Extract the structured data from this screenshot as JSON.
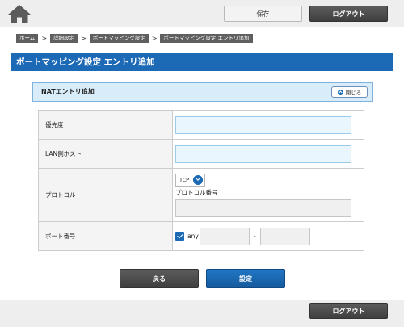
{
  "header": {
    "save_label": "保存",
    "logout_label": "ログアウト"
  },
  "breadcrumb": [
    "ホーム",
    "詳細設定",
    "ポートマッピング設定",
    "ポートマッピング設定 エントリ追加"
  ],
  "page_title": "ポートマッピング設定 エントリ追加",
  "section": {
    "title": "NATエントリ追加",
    "close_label": "閉じる"
  },
  "form": {
    "priority_label": "優先度",
    "priority_value": "",
    "lan_host_label": "LAN側ホスト",
    "lan_host_value": "",
    "protocol_label": "プロトコル",
    "protocol_selected": "TCP",
    "protocol_number_label": "プロトコル番号",
    "protocol_number_value": "",
    "port_label": "ポート番号",
    "port_any_label": "any",
    "port_any_checked": true,
    "port_separator": "-",
    "port_from_value": "",
    "port_to_value": ""
  },
  "actions": {
    "back_label": "戻る",
    "submit_label": "設定"
  },
  "footer": {
    "logout_label": "ログアウト"
  },
  "colors": {
    "accent": "#1c69b6",
    "input_bg": "#eaf6fe",
    "section_bg": "#d9ecfa",
    "dark_button": "#4a4a4a"
  }
}
